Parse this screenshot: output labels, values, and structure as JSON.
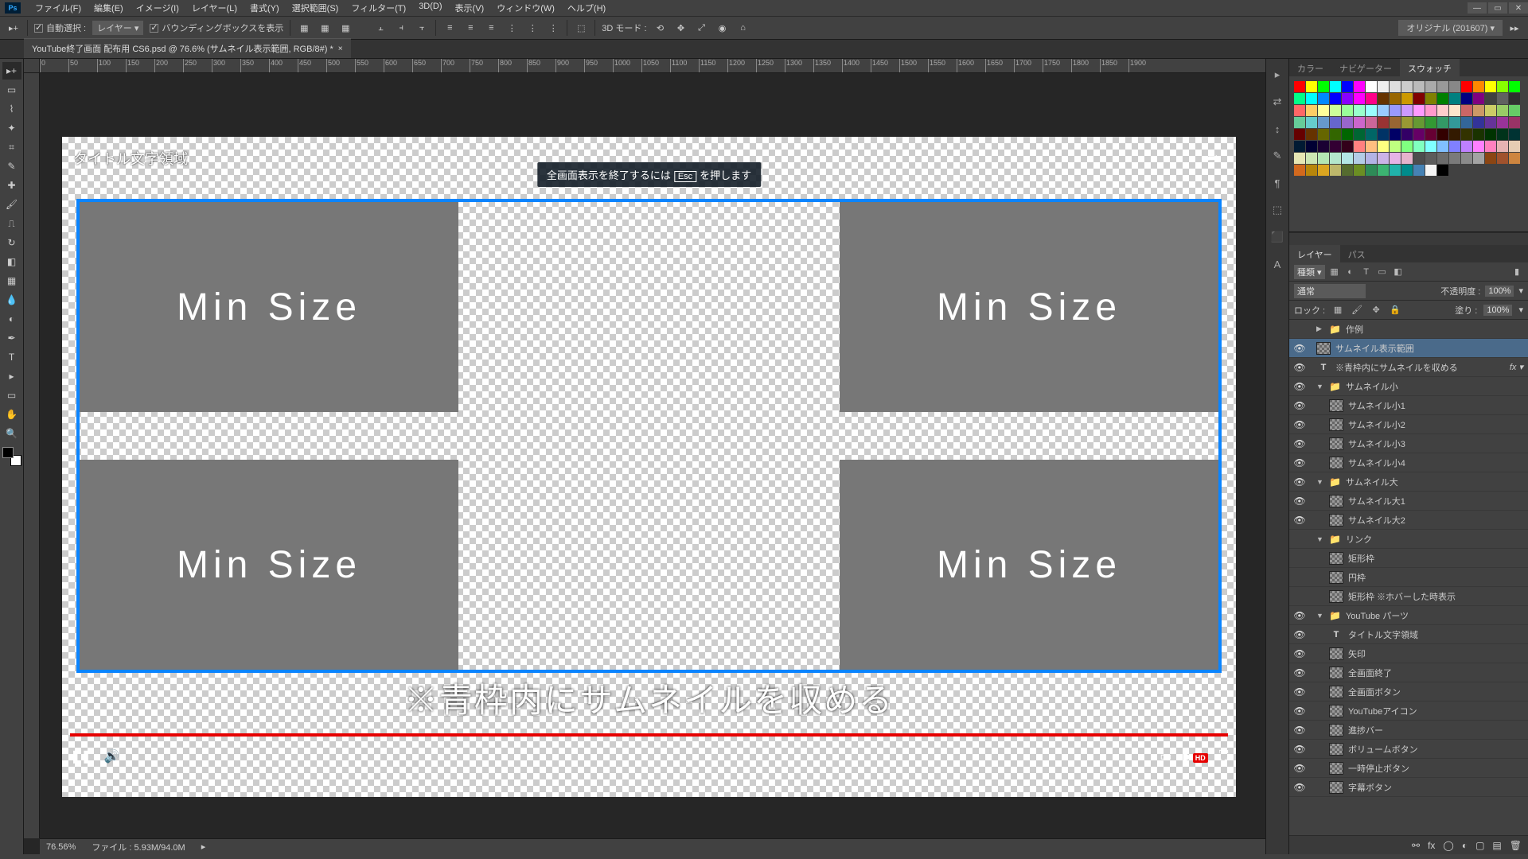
{
  "menu": [
    "ファイル(F)",
    "編集(E)",
    "イメージ(I)",
    "レイヤー(L)",
    "書式(Y)",
    "選択範囲(S)",
    "フィルター(T)",
    "3D(D)",
    "表示(V)",
    "ウィンドウ(W)",
    "ヘルプ(H)"
  ],
  "options": {
    "auto_select": "自動選択 :",
    "auto_select_mode": "レイヤー ▾",
    "bounding": "バウンディングボックスを表示",
    "three_d": "3D モード :",
    "workspace": "オリジナル (201607)"
  },
  "tab": {
    "title": "YouTube終了画面 配布用 CS6.psd @ 76.6% (サムネイル表示範囲, RGB/8#) *"
  },
  "ruler_h": [
    "0",
    "50",
    "100",
    "150",
    "200",
    "250",
    "300",
    "350",
    "400",
    "450",
    "500",
    "550",
    "600",
    "650",
    "700",
    "750",
    "800",
    "850",
    "900",
    "950",
    "1000",
    "1050",
    "1100",
    "1150",
    "1200",
    "1250",
    "1300",
    "1350",
    "1400",
    "1450",
    "1500",
    "1550",
    "1600",
    "1650",
    "1700",
    "1750",
    "1800",
    "1850",
    "1900"
  ],
  "canvas": {
    "title_area": "タイトル文字領域",
    "esc_pre": "全画面表示を終了するには",
    "esc_key": "Esc",
    "esc_post": "を押します",
    "thumb_label": "Min Size",
    "caption": "※青枠内にサムネイルを収める"
  },
  "status": {
    "zoom": "76.56%",
    "file": "ファイル : 5.93M/94.0M"
  },
  "right_tabs_top": [
    "カラー",
    "ナビゲーター",
    "スウォッチ"
  ],
  "right_tabs_layers": [
    "レイヤー",
    "パス"
  ],
  "layer_opts": {
    "kind": "種類 ▾",
    "blend": "通常",
    "opacity_label": "不透明度 :",
    "opacity": "100%",
    "lock_label": "ロック :",
    "fill_label": "塗り :",
    "fill": "100%"
  },
  "layers": [
    {
      "type": "group",
      "name": "作例",
      "vis": false,
      "open": false,
      "indent": 0
    },
    {
      "type": "layer",
      "name": "サムネイル表示範囲",
      "vis": true,
      "indent": 0,
      "sel": true
    },
    {
      "type": "text",
      "name": "※青枠内にサムネイルを収める",
      "vis": true,
      "indent": 0,
      "fx": true
    },
    {
      "type": "group",
      "name": "サムネイル小",
      "vis": true,
      "open": true,
      "indent": 0
    },
    {
      "type": "layer",
      "name": "サムネイル小1",
      "vis": true,
      "indent": 1
    },
    {
      "type": "layer",
      "name": "サムネイル小2",
      "vis": true,
      "indent": 1
    },
    {
      "type": "layer",
      "name": "サムネイル小3",
      "vis": true,
      "indent": 1
    },
    {
      "type": "layer",
      "name": "サムネイル小4",
      "vis": true,
      "indent": 1
    },
    {
      "type": "group",
      "name": "サムネイル大",
      "vis": true,
      "open": true,
      "indent": 0
    },
    {
      "type": "layer",
      "name": "サムネイル大1",
      "vis": true,
      "indent": 1
    },
    {
      "type": "layer",
      "name": "サムネイル大2",
      "vis": true,
      "indent": 1
    },
    {
      "type": "group",
      "name": "リンク",
      "vis": false,
      "open": true,
      "indent": 0
    },
    {
      "type": "layer",
      "name": "矩形枠",
      "vis": false,
      "indent": 1
    },
    {
      "type": "layer",
      "name": "円枠",
      "vis": false,
      "indent": 1
    },
    {
      "type": "layer",
      "name": "矩形枠 ※ホバーした時表示",
      "vis": false,
      "indent": 1
    },
    {
      "type": "group",
      "name": "YouTube パーツ",
      "vis": true,
      "open": true,
      "indent": 0
    },
    {
      "type": "text",
      "name": "タイトル文字領域",
      "vis": true,
      "indent": 1
    },
    {
      "type": "layer",
      "name": "矢印",
      "vis": true,
      "indent": 1
    },
    {
      "type": "layer",
      "name": "全画面終了",
      "vis": true,
      "indent": 1
    },
    {
      "type": "layer",
      "name": "全画面ボタン",
      "vis": true,
      "indent": 1
    },
    {
      "type": "layer",
      "name": "YouTubeアイコン",
      "vis": true,
      "indent": 1
    },
    {
      "type": "layer",
      "name": "進捗バー",
      "vis": true,
      "indent": 1
    },
    {
      "type": "layer",
      "name": "ボリュームボタン",
      "vis": true,
      "indent": 1
    },
    {
      "type": "layer",
      "name": "一時停止ボタン",
      "vis": true,
      "indent": 1
    },
    {
      "type": "layer",
      "name": "字幕ボタン",
      "vis": true,
      "indent": 1
    }
  ],
  "swatch_colors": [
    "#ff0000",
    "#ffff00",
    "#00ff00",
    "#00ffff",
    "#0000ff",
    "#ff00ff",
    "#ffffff",
    "#eeeeee",
    "#dddddd",
    "#cccccc",
    "#bbbbbb",
    "#aaaaaa",
    "#999999",
    "#888888",
    "#ff0000",
    "#ff8800",
    "#ffff00",
    "#88ff00",
    "#00ff00",
    "#00ff88",
    "#00ffff",
    "#0088ff",
    "#0000ff",
    "#8800ff",
    "#ff00ff",
    "#ff0088",
    "#663300",
    "#996600",
    "#cc9900",
    "#800000",
    "#808000",
    "#008000",
    "#008080",
    "#000080",
    "#800080",
    "#404040",
    "#606060",
    "#303030",
    "#ff6666",
    "#ffcc66",
    "#ffff99",
    "#ccff99",
    "#99ff99",
    "#99ffcc",
    "#99ffff",
    "#99ccff",
    "#9999ff",
    "#cc99ff",
    "#ff99ff",
    "#ff99cc",
    "#ffcccc",
    "#ffe6cc",
    "#cc6666",
    "#cc9966",
    "#cccc66",
    "#99cc66",
    "#66cc66",
    "#66cc99",
    "#66cccc",
    "#6699cc",
    "#6666cc",
    "#9966cc",
    "#cc66cc",
    "#cc6699",
    "#993333",
    "#996633",
    "#999933",
    "#669933",
    "#339933",
    "#339966",
    "#339999",
    "#336699",
    "#333399",
    "#663399",
    "#993399",
    "#993366",
    "#660000",
    "#663300",
    "#666600",
    "#336600",
    "#006600",
    "#006633",
    "#006666",
    "#003366",
    "#000066",
    "#330066",
    "#660066",
    "#660033",
    "#330000",
    "#331a00",
    "#333300",
    "#1a3300",
    "#003300",
    "#00331a",
    "#003333",
    "#001a33",
    "#000033",
    "#1a0033",
    "#330033",
    "#33001a",
    "#ff8080",
    "#ffbf80",
    "#ffff80",
    "#bfff80",
    "#80ff80",
    "#80ffbf",
    "#80ffff",
    "#80bfff",
    "#8080ff",
    "#bf80ff",
    "#ff80ff",
    "#ff80bf",
    "#e6b3b3",
    "#e6ccb3",
    "#e6e6b3",
    "#cce6b3",
    "#b3e6b3",
    "#b3e6cc",
    "#b3e6e6",
    "#b3cce6",
    "#b3b3e6",
    "#ccb3e6",
    "#e6b3e6",
    "#e6b3cc",
    "#4d4d4d",
    "#5c5c5c",
    "#6b6b6b",
    "#7a7a7a",
    "#8a8a8a",
    "#a3a3a3",
    "#8b4513",
    "#a0522d",
    "#cd853f",
    "#d2691e",
    "#b8860b",
    "#daa520",
    "#bdb76b",
    "#556b2f",
    "#6b8e23",
    "#2e8b57",
    "#3cb371",
    "#20b2aa",
    "#008b8b",
    "#4682b4",
    "#f5f5f5",
    "#000000"
  ]
}
